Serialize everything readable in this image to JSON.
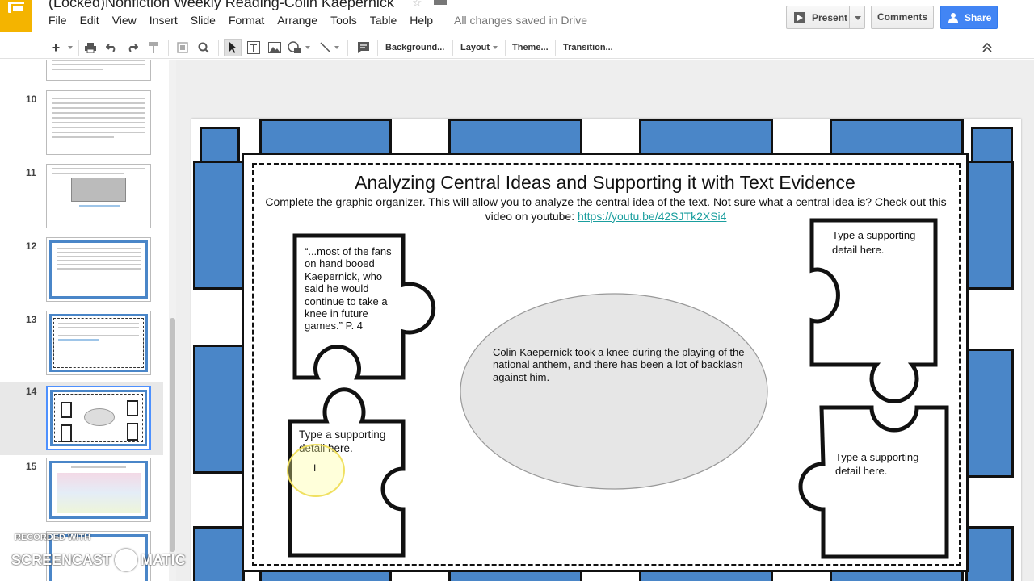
{
  "header": {
    "doc_title": "(Locked)Nonfiction Weekly Reading-Colin Kaepernick",
    "menu": [
      "File",
      "Edit",
      "View",
      "Insert",
      "Slide",
      "Format",
      "Arrange",
      "Tools",
      "Table",
      "Help"
    ],
    "save_status": "All changes saved in Drive",
    "present_label": "Present",
    "comments_label": "Comments",
    "share_label": "Share"
  },
  "toolbar": {
    "background_label": "Background...",
    "layout_label": "Layout",
    "theme_label": "Theme...",
    "transition_label": "Transition..."
  },
  "filmstrip": {
    "slides": [
      {
        "number": "10"
      },
      {
        "number": "11"
      },
      {
        "number": "12"
      },
      {
        "number": "13"
      },
      {
        "number": "14",
        "selected": true
      },
      {
        "number": "15"
      }
    ]
  },
  "slide": {
    "title": "Analyzing Central Ideas and Supporting it with Text Evidence",
    "instructions": "Complete the graphic organizer.  This will allow you to analyze the central idea of the text.  Not sure what a central idea is?  Check out this video on youtube: ",
    "video_link": "https://youtu.be/42SJTk2XSi4",
    "quote_text": "“...most of the fans on hand booed Kaepernick, who said he would continue to take a knee in future games.” P. 4",
    "central_idea": "Colin Kaepernick took a knee during the playing of the national anthem, and there has been a lot of backlash against him.",
    "detail_bottom_left": "Type a supporting detail here.",
    "detail_top_right": "Type a supporting detail here.",
    "detail_bottom_right": "Type a supporting detail here."
  },
  "watermark": {
    "line1": "RECORDED WITH",
    "line2_left": "SCREENCAST",
    "line2_right": "MATIC"
  },
  "colors": {
    "accent_blue": "#4a86c8",
    "share_blue": "#4285f4",
    "logo_yellow": "#f4b400",
    "link_teal": "#1a9e9e"
  }
}
